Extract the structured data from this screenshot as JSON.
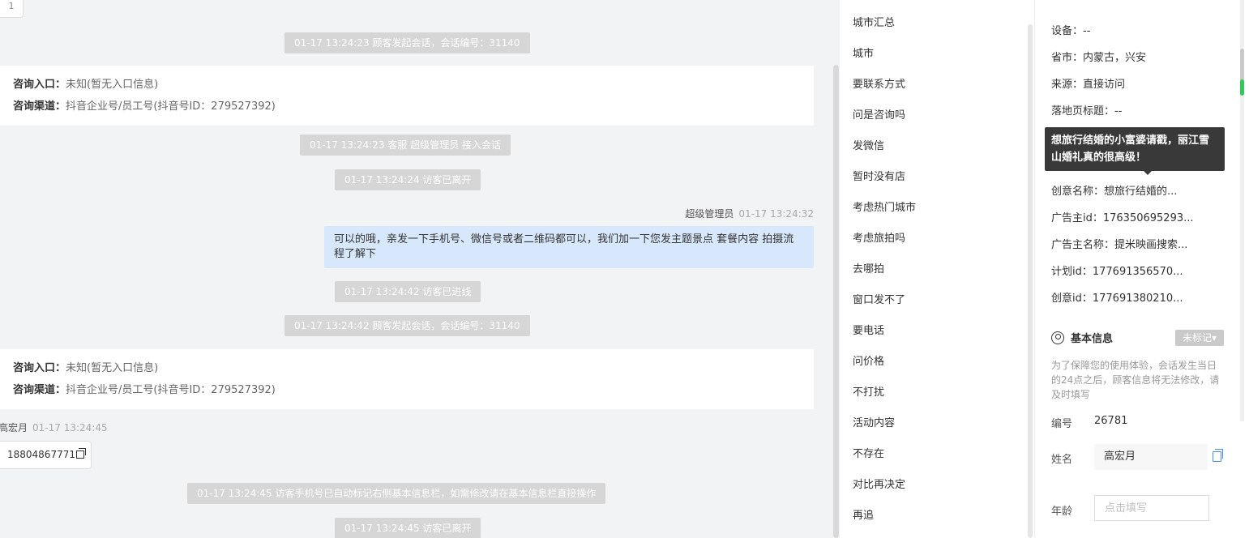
{
  "chat": {
    "page_badge": "1",
    "system_messages": [
      "01-17 13:24:23 顾客发起会话，会话编号：31140",
      "01-17 13:24:23 客服 超级管理员 接入会话",
      "01-17 13:24:24 访客已离开",
      "01-17 13:24:42 访客已进线",
      "01-17 13:24:42 顾客发起会话，会话编号：31140",
      "01-17 13:24:45 访客手机号已自动标记右侧基本信息栏，如需修改请在基本信息栏直接操作",
      "01-17 13:24:45 访客已离开"
    ],
    "info_cards": [
      {
        "entry_label": "咨询入口：",
        "entry_value": "未知(暂无入口信息)",
        "channel_label": "咨询渠道：",
        "channel_value": "抖音企业号/员工号(抖音号ID：279527392)"
      },
      {
        "entry_label": "咨询入口：",
        "entry_value": "未知(暂无入口信息)",
        "channel_label": "咨询渠道：",
        "channel_value": "抖音企业号/员工号(抖音号ID：279527392)"
      }
    ],
    "agent": {
      "name": "超级管理员",
      "time": "01-17 13:24:32",
      "message": "可以的哦，亲发一下手机号、微信号或者二维码都可以，我们加一下您发主题景点 套餐内容 拍摄流程了解下"
    },
    "visitor": {
      "name": "高宏月",
      "time": "01-17 13:24:45",
      "message": "18804867771"
    }
  },
  "quick_replies": [
    "城市汇总",
    "城市",
    "要联系方式",
    "问是咨询吗",
    "发微信",
    "暂时没有店",
    "考虑热门城市",
    "考虑旅拍吗",
    "去哪拍",
    "窗口发不了",
    "要电话",
    "问价格",
    "不打扰",
    "活动内容",
    "不存在",
    "对比再决定",
    "再追"
  ],
  "source": {
    "rows": [
      "设备：--",
      "省市：内蒙古，兴安",
      "来源：直接访问",
      "落地页标题：--",
      "创意名称：想旅行结婚的...",
      "广告主id：176350695293...",
      "广告主名称：提米映画搜索...",
      "计划id：177691356570...",
      "创意id：177691380210..."
    ],
    "tooltip": "想旅行结婚的小富婆请戳，丽江雪山婚礼真的很高级！"
  },
  "basic": {
    "title": "基本信息",
    "mark_label": "未标记▾",
    "notice": "为了保障您的使用体验，会话发生当日的24点之后，顾客信息将无法修改，请及时填写",
    "id_label": "编号",
    "id_value": "26781",
    "name_label": "姓名",
    "name_value": "高宏月",
    "age_label": "年龄",
    "age_placeholder": "点击填写"
  }
}
